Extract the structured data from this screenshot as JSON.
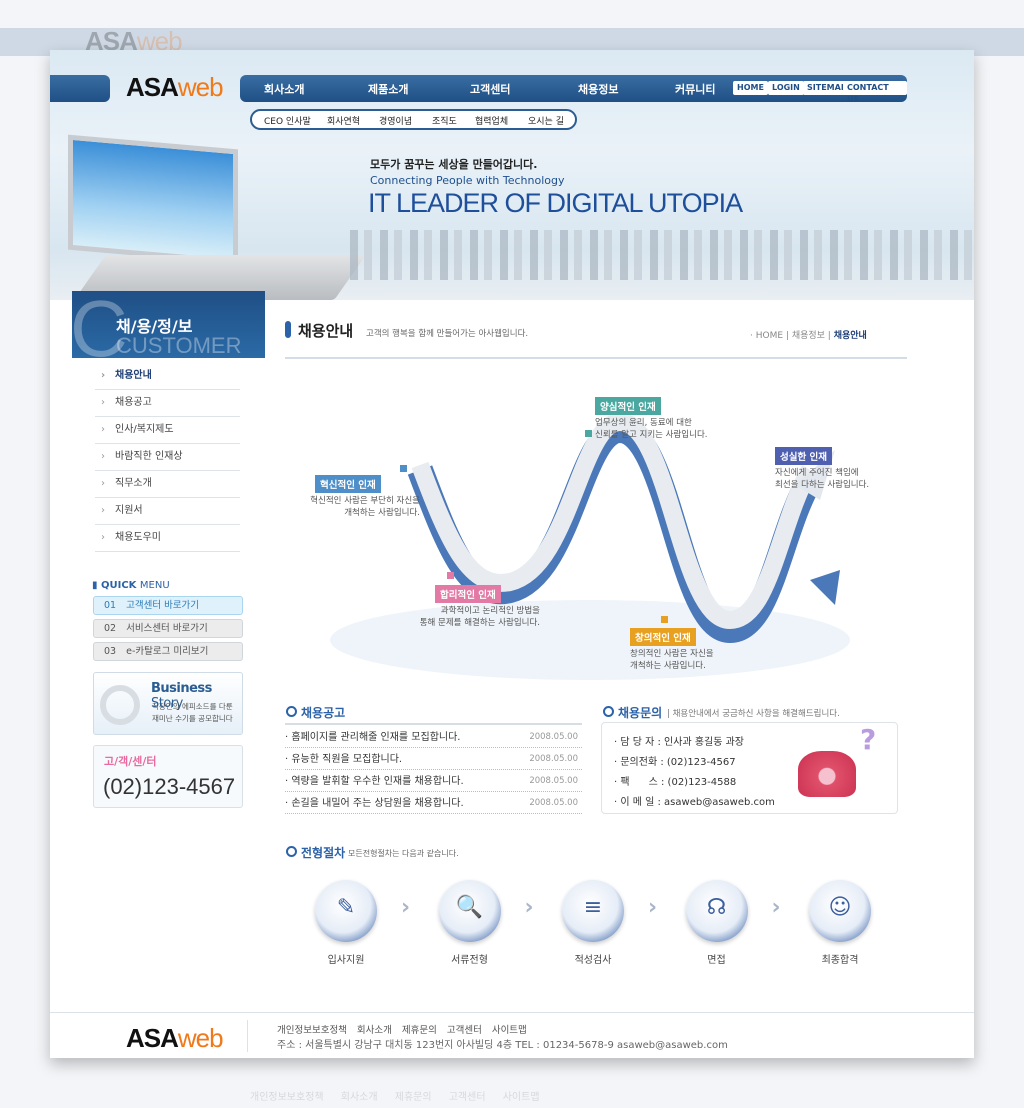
{
  "brand": {
    "logo_a": "ASA",
    "logo_b": "web"
  },
  "nav": {
    "items": [
      "회사소개",
      "제품소개",
      "고객센터",
      "채용정보",
      "커뮤니티"
    ],
    "top_buttons": [
      "HOME",
      "LOGIN",
      "SITEMAP",
      "CONTACT US"
    ],
    "sub_items": [
      "CEO 인사말",
      "회사연혁",
      "경영이념",
      "조직도",
      "협력업체",
      "오시는 길"
    ]
  },
  "banner": {
    "tagline_ko": "모두가 꿈꾸는 세상을 만들어갑니다.",
    "tagline_en": "Connecting People with Technology",
    "headline": "IT LEADER OF DIGITAL UTOPIA"
  },
  "sidebar": {
    "title": "채/용/정/보",
    "title_bg": "CUSTOMER",
    "items": [
      {
        "label": "채용안내",
        "active": true
      },
      {
        "label": "채용공고"
      },
      {
        "label": "인사/복지제도"
      },
      {
        "label": "바람직한 인재상"
      },
      {
        "label": "직무소개"
      },
      {
        "label": "지원서"
      },
      {
        "label": "채용도우미"
      }
    ],
    "quick_menu_title_a": "QUICK",
    "quick_menu_title_b": "MENU",
    "quick_items": [
      {
        "num": "01",
        "label": "고객센터 바로가기"
      },
      {
        "num": "02",
        "label": "서비스센터 바로가기"
      },
      {
        "num": "03",
        "label": "e-카탈로그 미리보기"
      }
    ],
    "business_story": {
      "title_a": "Business",
      "title_b": "Story",
      "desc1": "직장인의 에피소드를 다룬",
      "desc2": "재미난 수기를 공모합니다"
    },
    "customer_center": {
      "label": "고/객/센/터",
      "phone": "(02)123-4567"
    }
  },
  "content": {
    "title": "채용안내",
    "subtitle": "고객의 행복을 함께 만들어가는 아사웹입니다.",
    "breadcrumb": [
      "HOME",
      "채용정보",
      "채용안내"
    ],
    "talents": [
      {
        "title": "혁신적인 인재",
        "desc1": "혁신적인 사람은 부단히 자신을",
        "desc2": "개척하는 사람입니다.",
        "color": "#4f8fc9"
      },
      {
        "title": "합리적인 인재",
        "desc1": "과학적이고 논리적인 방법을",
        "desc2": "통해 문제를 해결하는 사람입니다.",
        "color": "#e27aa5"
      },
      {
        "title": "양심적인 인재",
        "desc1": "업무상의 윤리, 동료에 대한",
        "desc2": "신뢰를 알고 지키는 사람입니다.",
        "color": "#4aa8a0"
      },
      {
        "title": "창의적인 인재",
        "desc1": "창의적인 사람은 자신을",
        "desc2": "개척하는 사람입니다.",
        "color": "#e8a020"
      },
      {
        "title": "성실한 인재",
        "desc1": "자신에게 주어진 책임에",
        "desc2": "최선을 다하는 사람입니다.",
        "color": "#5060b0"
      }
    ],
    "notices": {
      "title": "채용공고",
      "rows": [
        {
          "text": "홈페이지를 관리해줄 인재를 모집합니다.",
          "date": "2008.05.00"
        },
        {
          "text": "유능한 직원을 모집합니다.",
          "date": "2008.05.00"
        },
        {
          "text": "역량을 발휘할 우수한 인재를 채용합니다.",
          "date": "2008.05.00"
        },
        {
          "text": "손길을 내밀어 주는 상담원을 채용합니다.",
          "date": "2008.05.00"
        }
      ]
    },
    "inquiry": {
      "title": "채용문의",
      "subtitle": "채용안내에서 궁금하신 사항을 해결해드립니다.",
      "lines": [
        "담 당 자 : 인사과 홍길동 과장",
        "문의전화 : (02)123-4567",
        "팩      스 : (02)123-4588",
        "이 메 일 : asaweb@asaweb.com"
      ]
    },
    "process": {
      "title": "전형절차",
      "subtitle": "모든전형절차는 다음과 같습니다.",
      "steps": [
        "입사지원",
        "서류전형",
        "적성검사",
        "면접",
        "최종합격"
      ]
    }
  },
  "footer": {
    "links": [
      "개인정보보호정책",
      "회사소개",
      "제휴문의",
      "고객센터",
      "사이트맵"
    ],
    "address": "주소 : 서울특별시 강남구 대치동 123번지 아사빌딩 4층 TEL : 01234-5678-9 asaweb@asaweb.com"
  }
}
